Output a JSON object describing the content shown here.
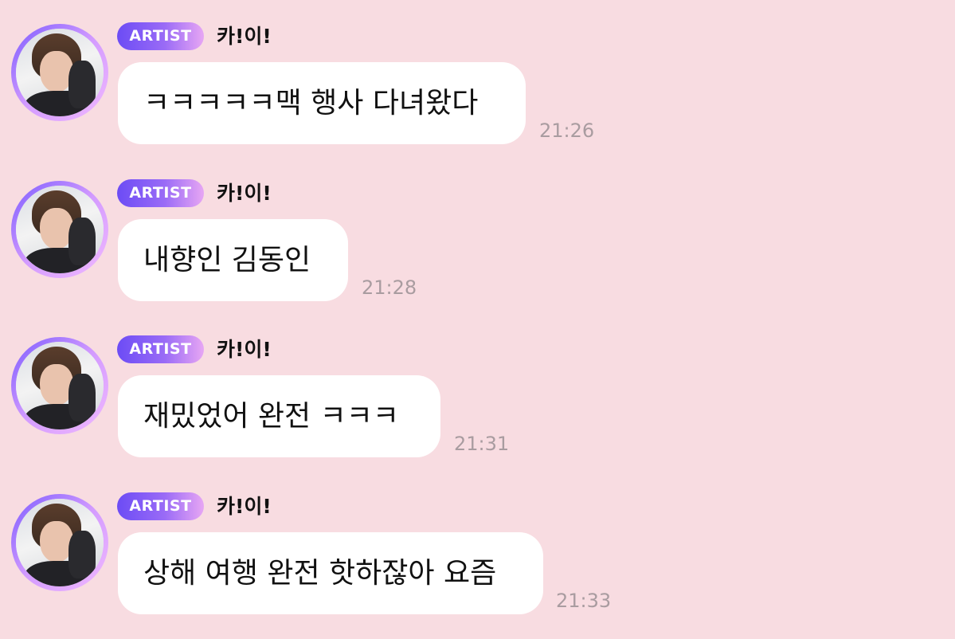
{
  "messages": [
    {
      "badge": "ARTIST",
      "sender": "카!이!",
      "text": "ㅋㅋㅋㅋㅋ맥 행사 다녀왔다",
      "time": "21:26"
    },
    {
      "badge": "ARTIST",
      "sender": "카!이!",
      "text": "내향인 김동인",
      "time": "21:28"
    },
    {
      "badge": "ARTIST",
      "sender": "카!이!",
      "text": "재밌었어 완전 ㅋㅋㅋ",
      "time": "21:31"
    },
    {
      "badge": "ARTIST",
      "sender": "카!이!",
      "text": "상해 여행 완전 핫하잖아 요즘",
      "time": "21:33"
    }
  ],
  "colors": {
    "background": "#f8dce1",
    "bubble": "#ffffff",
    "badge_start": "#6c4cf5",
    "badge_end": "#e7a6f4",
    "timestamp": "#a99ca0"
  }
}
